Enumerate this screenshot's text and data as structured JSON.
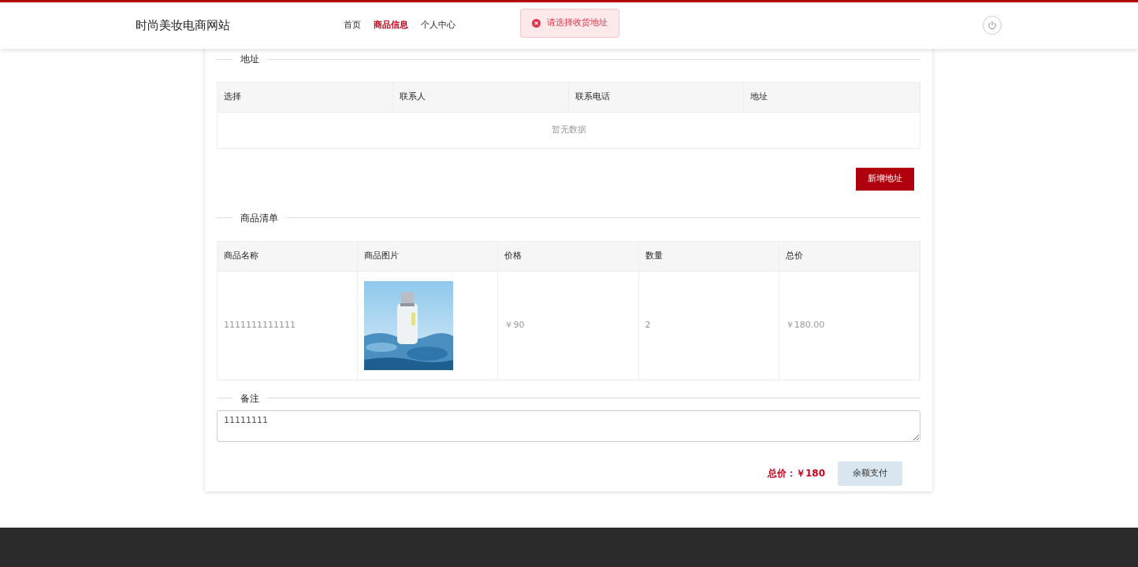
{
  "header": {
    "brand": "时尚美妆电商网站",
    "nav": [
      {
        "label": "首页",
        "selected": false
      },
      {
        "label": "商品信息",
        "selected": true
      },
      {
        "label": "个人中心",
        "selected": false
      }
    ]
  },
  "toast": {
    "kind": "error",
    "message": "请选择收货地址"
  },
  "address": {
    "title": "地址",
    "columns": [
      "选择",
      "联系人",
      "联系电话",
      "地址"
    ],
    "empty_text": "暂无数据",
    "add_button": "新增地址"
  },
  "goods": {
    "title": "商品清单",
    "columns": [
      "商品名称",
      "商品图片",
      "价格",
      "数量",
      "总价"
    ],
    "rows": [
      {
        "name": "1111111111111",
        "price": "￥90",
        "quantity": "2",
        "total": "￥180.00"
      }
    ]
  },
  "remark": {
    "title": "备注",
    "value": "11111111"
  },
  "summary": {
    "total": "总价：￥180",
    "pay_button": "余额支付"
  }
}
